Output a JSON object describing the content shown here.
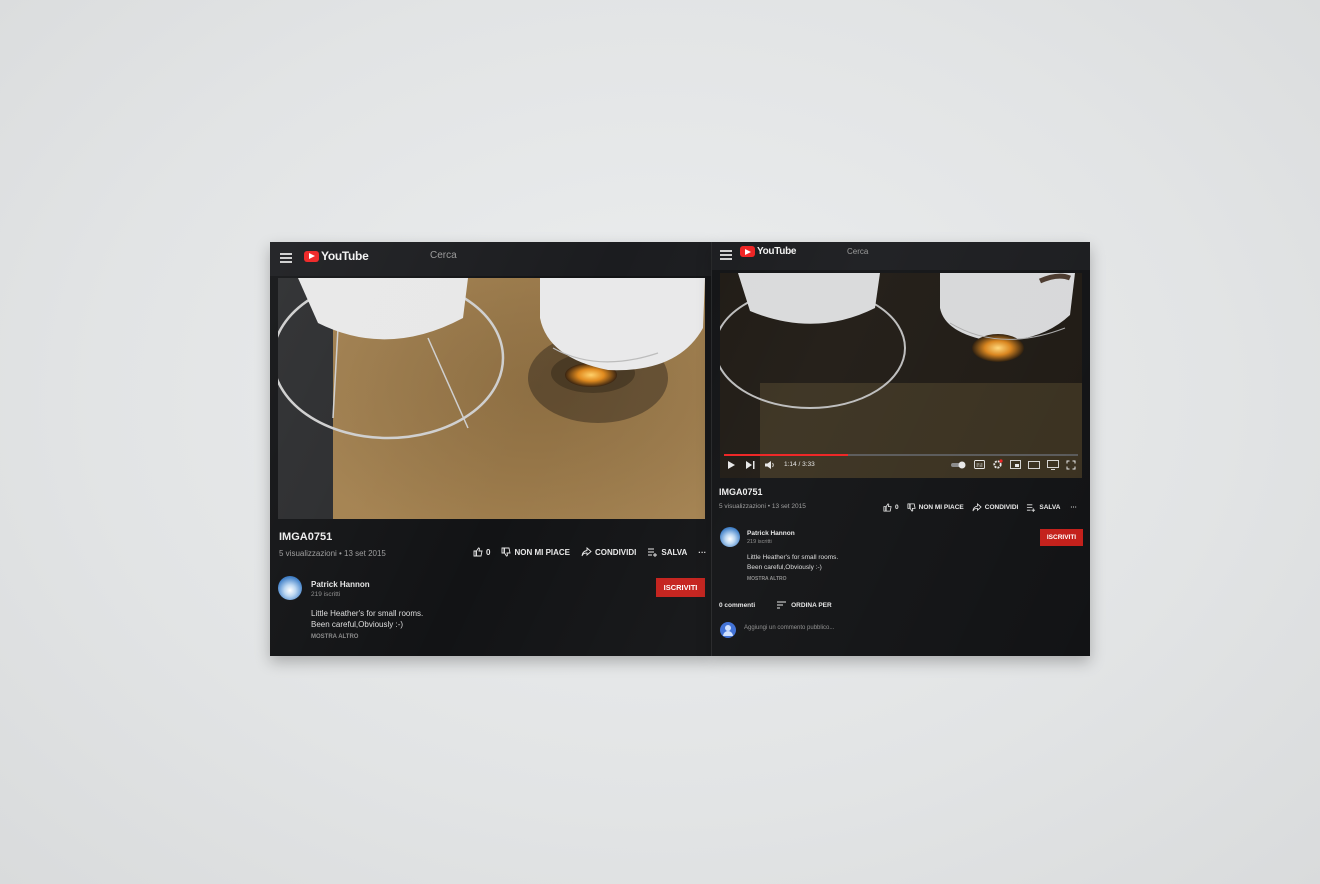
{
  "left_screen": {
    "header": {
      "logo_text": "YouTube",
      "search_placeholder": "Cerca"
    },
    "video": {
      "title": "IMGA0751",
      "meta": "5 visualizzazioni • 13 set 2015"
    },
    "actions": {
      "likes": "0",
      "dislike_label": "NON MI PIACE",
      "share_label": "CONDIVIDI",
      "save_label": "SALVA",
      "more_label": "···"
    },
    "channel": {
      "name": "Patrick Hannon",
      "subscribers": "219 iscritti",
      "subscribe_label": "ISCRIVITI"
    },
    "description": {
      "line1": "Little Heather's for small rooms.",
      "line2": "Been careful,Obviously :-)",
      "show_more": "MOSTRA ALTRO"
    }
  },
  "right_screen": {
    "header": {
      "logo_text": "YouTube",
      "search_placeholder": "Cerca"
    },
    "player": {
      "time": "1:14 / 3:33",
      "progress": 0.35
    },
    "video": {
      "title": "IMGA0751",
      "meta": "5 visualizzazioni • 13 set 2015"
    },
    "actions": {
      "likes": "0",
      "dislike_label": "NON MI PIACE",
      "share_label": "CONDIVIDI",
      "save_label": "SALVA",
      "more_label": "···"
    },
    "channel": {
      "name": "Patrick Hannon",
      "subscribers": "219 iscritti",
      "subscribe_label": "ISCRIVITI"
    },
    "description": {
      "line1": "Little Heather's for small rooms.",
      "line2": "Been careful,Obviously :-)",
      "show_more": "MOSTRA ALTRO"
    },
    "comments": {
      "count_label": "0 commenti",
      "sort_label": "ORDINA PER",
      "add_placeholder": "Aggiungi un commento pubblico..."
    }
  },
  "colors": {
    "accent": "#c4201b",
    "background": "#121315",
    "wall": "#e4e6e7"
  },
  "icons": [
    "menu-icon",
    "youtube-logo-icon",
    "thumbs-up-icon",
    "thumbs-down-icon",
    "share-icon",
    "save-playlist-icon",
    "more-icon",
    "play-icon",
    "next-icon",
    "volume-icon",
    "autoplay-toggle-icon",
    "subtitles-icon",
    "settings-icon",
    "miniplayer-icon",
    "theater-icon",
    "cast-icon",
    "fullscreen-icon",
    "sort-icon",
    "user-avatar-icon"
  ]
}
